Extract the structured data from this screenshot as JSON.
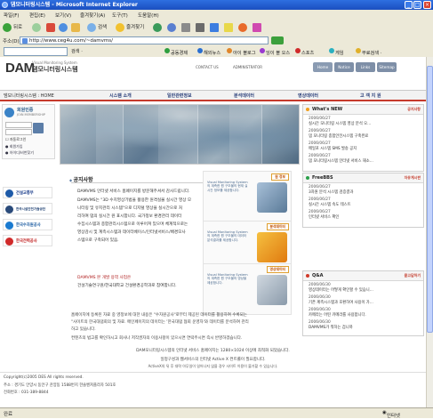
{
  "window": {
    "title": "댐모니터링시스템 - Microsoft Internet Explorer"
  },
  "menu": [
    "파일(F)",
    "편집(E)",
    "보기(V)",
    "즐겨찾기(A)",
    "도구(T)",
    "도움말(H)"
  ],
  "toolbar": {
    "back": "뒤로",
    "search": "검색",
    "favorites": "즐겨찾기"
  },
  "address": {
    "label": "주소(D)",
    "url": "http://www.ceg4u.com/~damvms/"
  },
  "links": [
    "검색 ·",
    "공동경제",
    "해외뉴스",
    "아이 블로그",
    "잉이 블 오스",
    "스포츠",
    "게임",
    "무료검색 ·"
  ],
  "site": {
    "logo_main": "DAM",
    "logo_sub_title": "Visual Monitoring System",
    "logo_korean": "댐모니터링시스템",
    "contact": "CONTACT US",
    "admin": "ADMINISTRATOR",
    "topnav": [
      "Home",
      "Notice",
      "Links",
      "Sitemap"
    ],
    "breadcrumb": "댐모니터링시스템 : HOME",
    "mainnav": [
      "시스템 소개",
      "일반관련정보",
      "분석데이터",
      "영상데이터",
      "고 객 지 원"
    ]
  },
  "login": {
    "title": "회원인증",
    "subtitle": "JOIN MEMBERSHIP",
    "remember": "자동로그인",
    "link1": "회원가입",
    "link2": "아이디/비번찾기"
  },
  "partners": [
    "건설교통부",
    "한국시설안전기술공단",
    "한국수자원공사",
    "한국전력공사"
  ],
  "notice": {
    "heading": "공지사항",
    "lines": [
      "DAMVMS 인터넷 서비스 홈페이지를 방문해주셔서 감사드립니다.",
      "DAMVMS는 \"3D 수치영상기법을 활용한 원격실물 실시간 영상 모",
      "니터링 및 유지관리 시스템\"으로 디지털 영상을 실시간으로 처",
      "리하여 댐의 실시간 원 표시합니다. 국가정보 환경관리 데이터",
      "수집시스템과 종합관리시스템으로 이루어져 있으며 체계적으로는",
      "영상감시 및 계측시스템과 데이터베이스/인터넷서비스/배경모사",
      "스템으로 구축되어 있음."
    ],
    "highlight_lines": [
      "DAMVMS 본 개발 용역 사업은",
      "건설기술연구원/한국대학교 건설환경공학과로 참여합니다."
    ],
    "cards": [
      {
        "tag": "원 정보",
        "caption": "Visual Monitoring System의 계측한 원 구조물의 현재 실시간 정보를 제공합니다."
      },
      {
        "tag": "분석데이터",
        "caption": "Visual Monitoring System의 계측한 원 구조물의 데이터 분석결과를 제공합니다."
      },
      {
        "tag": "영상데이터",
        "caption": "Visual Monitoring System의 계측한 원 구조물의 영상을 제공합니다."
      }
    ]
  },
  "whatsnew": {
    "title": "What's NEW",
    "more": "공지사항",
    "items": [
      {
        "date": "2006/06/27",
        "text": "실시간 모니터링 시스템 영상 분석 오..."
      },
      {
        "date": "2006/06/27",
        "text": "댐 모니터링 종합안전시스템 구축완료"
      },
      {
        "date": "2006/06/27",
        "text": "메일포 시스템 SMS 발송 공지"
      },
      {
        "date": "2006/06/27",
        "text": "댐 모니터링시스템 인터넷 서비스 재소..."
      }
    ]
  },
  "freebbs": {
    "title": "FreeBBS",
    "more": "자유게시판",
    "items": [
      {
        "date": "2006/06/27",
        "text": "3차원 분석 시스템 검증결과"
      },
      {
        "date": "2006/06/27",
        "text": "실시간 시스템 속도 테스트"
      },
      {
        "date": "2006/06/27",
        "text": "인터넷 서비스 확인"
      }
    ]
  },
  "qna": {
    "title": "Q&A",
    "more": "묻고답하기",
    "items": [
      {
        "date": "2006/06/30",
        "text": "영상데이터는 어떻게 확인할 수 있습니..."
      },
      {
        "date": "2006/06/30",
        "text": "기존 계측시스템과 호환하여 사용이 가..."
      },
      {
        "date": "2006/06/30",
        "text": "카메라는 어떤 카메라를 사용합니다."
      },
      {
        "date": "2006/06/30",
        "text": "DAMVMS가 뭐하는 겁니까"
      }
    ]
  },
  "body_text": [
    "홈페이지에 등록된 자료 중 영정보에 대한 내용은 \"수자원공사\"로부터 제공된 데이터를 활용하여 수록되는",
    "\"사이트의 한국대댐회의 및 자료. 메인페이지의 데이터는 '한국대댐 협회 운영자'와 데이터를 분석하여 관리",
    "하고 있습니다.",
    "컨텐츠의 법고를 확인하시고 회사나 저작권자의 이용사항이 있으시면 연락주시면 즉시 반영하겠습니다."
  ],
  "resolution_note": "DAM모니터링시스템의 인터넷 서비스 홈페이지는 1280×1024 이상에 최적화 되었습니다.",
  "activex_note": "일정구성과 웹서비스의 인터넷 Active X 컨트롤이 필요합니다.",
  "activex_note2": "ActiveX의 뒤 후 대략 아무일이 일어나지 않을 경우 사이트 이용이 불가할 수 있습니다.",
  "footer": {
    "copyright": "Copyright(c)2005 DES All rights reserved.",
    "address": "주소 : 경기도 안양시 동안구 관양동 1588번지 한솔벤쳐플라자 501호",
    "phone": "전화번호 : 031-389-8844"
  },
  "status": {
    "text": "완료",
    "zone": "인터넷"
  }
}
